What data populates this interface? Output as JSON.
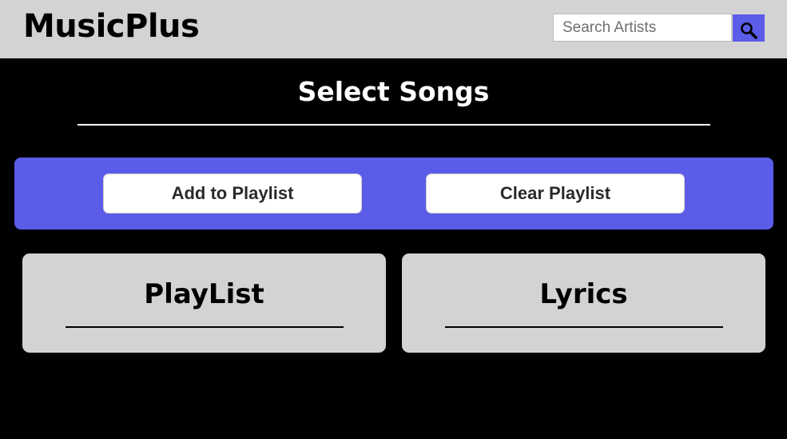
{
  "header": {
    "brand": "MusicPlus",
    "search": {
      "placeholder": "Search Artists",
      "value": "",
      "button_icon": "search-icon"
    }
  },
  "main": {
    "title": "Select Songs",
    "actions": {
      "add_label": "Add to Playlist",
      "clear_label": "Clear Playlist"
    },
    "panels": {
      "playlist_title": "PlayList",
      "lyrics_title": "Lyrics"
    }
  },
  "colors": {
    "header_bg": "#d3d3d3",
    "page_bg": "#000000",
    "accent": "#5b5ce8",
    "panel_bg": "#d3d3d3",
    "button_bg": "#ffffff"
  }
}
